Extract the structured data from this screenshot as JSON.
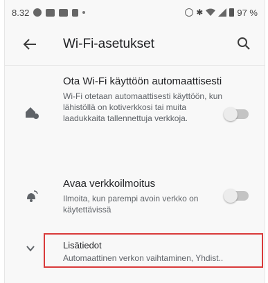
{
  "status_bar": {
    "time": "8.32",
    "battery_pct": "97 %"
  },
  "app_bar": {
    "title": "Wi-Fi-asetukset"
  },
  "settings": [
    {
      "title": "Ota Wi-Fi käyttöön automaattisesti",
      "subtitle": "Wi-Fi otetaan automaattisesti käyttöön, kun lähistöllä on kotiverkkosi tai muita laadukkaita tallennettuja verkkoja.",
      "enabled": false
    },
    {
      "title": "Avaa verkkoilmoitus",
      "subtitle": "Ilmoita, kun parempi avoin verkko on käytettävissä",
      "enabled": false
    }
  ],
  "advanced": {
    "title": "Lisätiedot",
    "subtitle": "Automaattinen verkon vaihtaminen, Yhdist.."
  },
  "colors": {
    "highlight_border": "#d93a3a",
    "switch_track": "#c4c4c4"
  }
}
